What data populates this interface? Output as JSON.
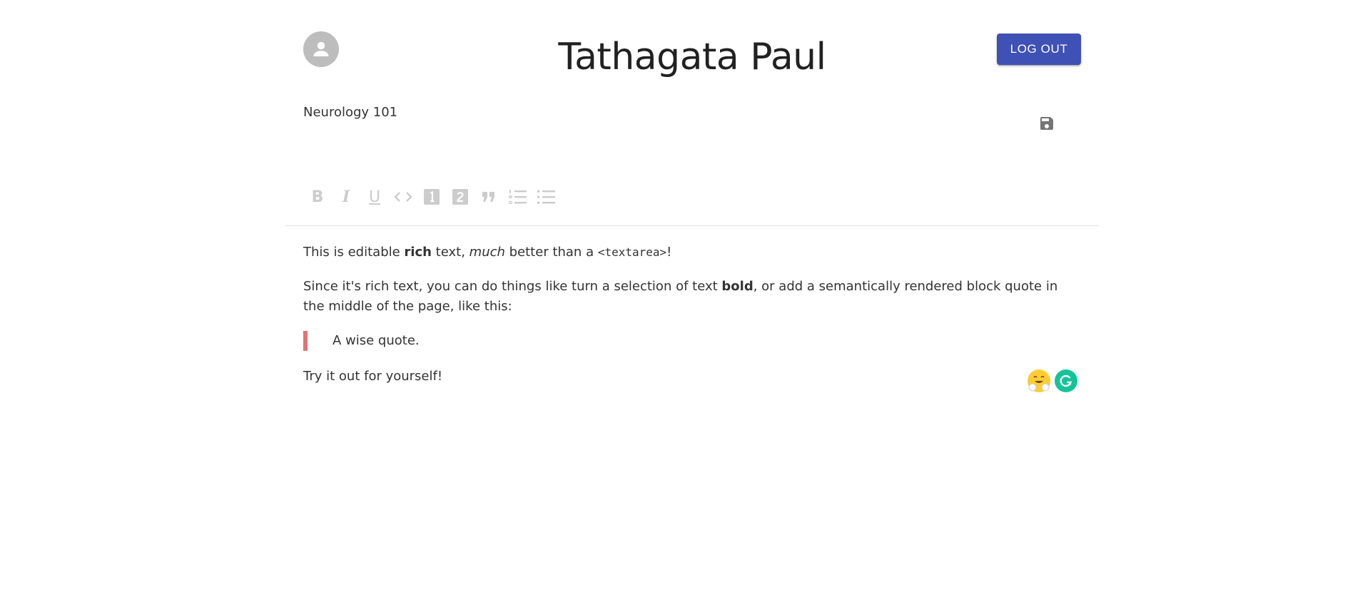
{
  "header": {
    "title": "Tathagata Paul",
    "logout_label": "LOG OUT"
  },
  "note": {
    "title": "Neurology 101"
  },
  "toolbar": {
    "bold": "B",
    "italic": "I",
    "underline": "U"
  },
  "editor": {
    "p1": {
      "a": "This is editable ",
      "b": "rich",
      "c": " text, ",
      "d": "much",
      "e": " better than a ",
      "f": "<textarea>",
      "g": "!"
    },
    "p2": {
      "a": "Since it's rich text, you can do things like turn a selection of text ",
      "b": "bold",
      "c": ", or add a semantically rendered block quote in the middle of the page, like this:"
    },
    "quote": "A wise quote.",
    "p3": "Try it out for yourself!"
  },
  "colors": {
    "primary": "#3f51b5",
    "quote_border": "#e57373",
    "toolbar_icon": "#cccccc",
    "grammarly": "#15c39a"
  },
  "icons": [
    "account-circle-icon",
    "save-icon",
    "code-icon",
    "heading-one-icon",
    "heading-two-icon",
    "quote-icon",
    "numbered-list-icon",
    "bulleted-list-icon",
    "emoji-icon",
    "grammarly-icon"
  ]
}
